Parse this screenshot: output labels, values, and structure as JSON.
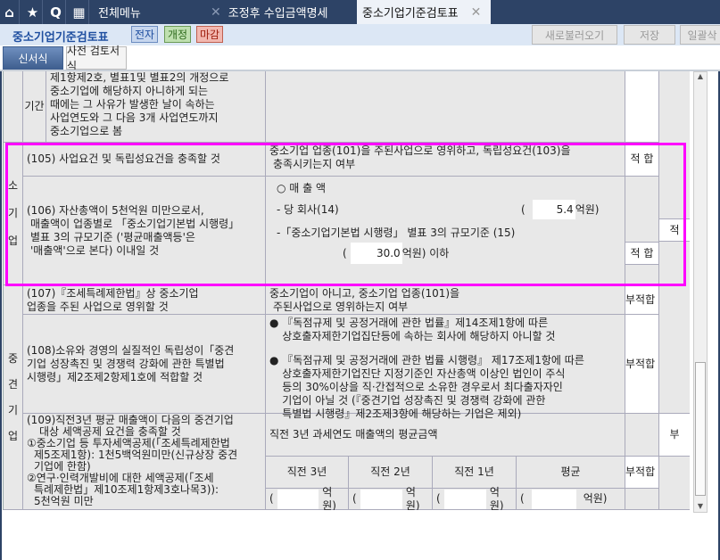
{
  "tabs": {
    "all_menu": "전체메뉴",
    "items": [
      {
        "label": "조정후 수입금액명세"
      },
      {
        "label": "중소기업기준검토표"
      }
    ]
  },
  "toolbar": {
    "title": "중소기업기준검토표",
    "badges": [
      "전자",
      "개정",
      "마감"
    ],
    "buttons": [
      "새로불러오기",
      "저장",
      "일괄삭"
    ]
  },
  "subtabs": [
    "신서식",
    "사전 검토서식"
  ],
  "top_row": {
    "side": "기간",
    "lines": [
      "제1항제2호, 별표1및 별표2의 개정으로",
      "중소기업에 해당하지 아니하게 되는",
      "때에는 그 사유가 발생한 날이 속하는",
      "사업연도와 그 다음 3개 사업연도까지",
      "중소기업으로 봄"
    ]
  },
  "small": {
    "category": "소기업",
    "r105": {
      "item": "(105) 사업요건 및 독립성요건을 충족할 것",
      "desc": "중소기업 업종(101)을 주된사업으로 영위하고, 독립성요건(103)을",
      "desc2": "충족시키는지 여부",
      "result": "적 합"
    },
    "r106": {
      "item": [
        "(106) 자산총액이 5천억원 미만으로서,",
        "매출액이 업종별로 「중소기업기본법 시행령」",
        "별표 3의 규모기준 ('평균매출액등'은",
        "'매출액'으로 본다) 이내일 것"
      ],
      "sales_label": "○ 매 출 액",
      "company_label": "- 당 회사(14)",
      "company_value": "5.4",
      "unit": "억원",
      "criterion_label": "-「중소기업기본법 시행령」 별표 3의 규모기준 (15)",
      "criterion_value": "30.0",
      "below": "억원) 이하",
      "result": "적 합",
      "final": "적"
    }
  },
  "mid": {
    "category": "중견기업",
    "r107": {
      "item": [
        "(107)『조세특례제한법』상 중소기업",
        "업종을 주된 사업으로 영위할 것"
      ],
      "desc": [
        "중소기업이 아니고, 중소기업 업종(101)을",
        "주된사업으로 영위하는지 여부"
      ],
      "result": "부적합"
    },
    "r108": {
      "item": [
        "(108)소유와 경영의 실질적인 독립성이「중견",
        "기업 성장촉진 및 경쟁력 강화에 관한 특별법",
        "시행령」제2조제2항제1호에 적합할 것"
      ],
      "b1": [
        "『독점규제 및 공정거래에 관한 법률』제14조제1항에 따른",
        "상호출자제한기업집단등에 속하는 회사에 해당하지 아니할 것"
      ],
      "b2": [
        "『독점규제 및 공정거래에 관한 법률 시행령』 제17조제1항에 따른",
        "상호출자제한기업진단 지정기준인 자산총액 이상인 법인이 주식",
        "등의 30%이상을 직·간접적으로 소유한 경우로서 최다출자자인",
        "기업이 아닐 것 (『중견기업 성장촉진 및 경쟁력 강화에 관한",
        "특별법 시행령』제2조제3항에 해당하는 기업은 제외)"
      ],
      "result": "부적합"
    },
    "r109": {
      "item": [
        "(109)직전3년 평균 매출액이 다음의 중견기업",
        "대상 세액공제 요건을 충족할 것",
        "①중소기업 등 투자세액공제(「조세특례제한법",
        "제5조제1항): 1천5백억원미만(신규상장 중견",
        "기업에 한함)",
        "②연구·인력개발비에 대한 세액공제(「조세",
        "특례제한법」제10조제1항제3호나목3)):",
        "5천억원 미만"
      ],
      "desc": "직전 3년 과세연도 매출액의 평균금액",
      "headers": [
        "직전 3년",
        "직전 2년",
        "직전 1년",
        "평균"
      ],
      "unit": "억원)",
      "result": "부적합",
      "final": "부"
    }
  }
}
